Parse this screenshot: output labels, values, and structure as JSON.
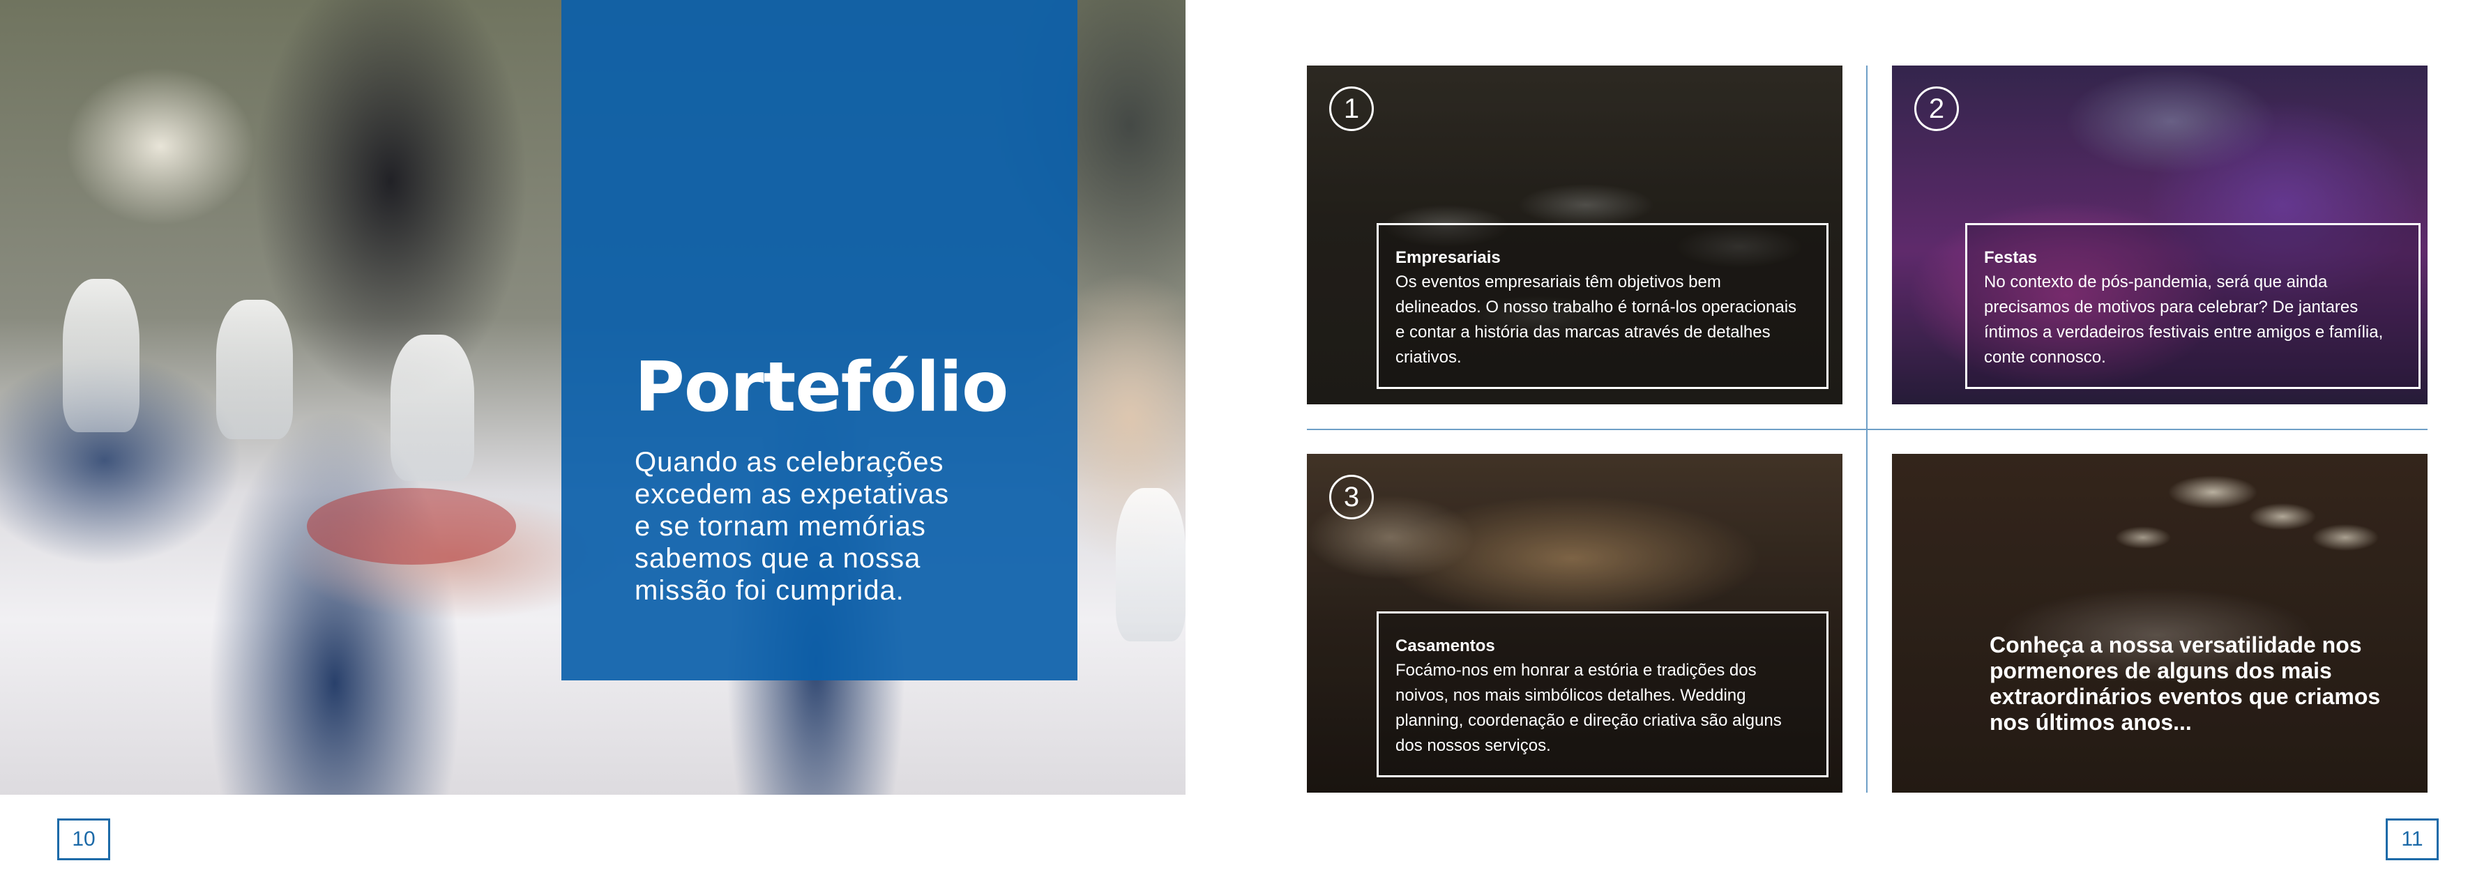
{
  "left_page": {
    "title": "Portefólio",
    "subtitle": "Quando as celebrações\nexcedem as expetativas\ne se tornam memórias\nsabemos que a nossa\nmissão foi cumprida.",
    "page_number": "10"
  },
  "right_page": {
    "cards": [
      {
        "number": "1",
        "title": "Empresariais",
        "body": "Os eventos empresariais têm objetivos bem delineados. O nosso trabalho é torná-los operacionais e contar a história das marcas através de detalhes criativos."
      },
      {
        "number": "2",
        "title": "Festas",
        "body": "No contexto de pós-pandemia, será que ainda precisamos de motivos para celebrar? De jantares íntimos a verdadeiros festivais entre amigos e família, conte connosco."
      },
      {
        "number": "3",
        "title": "Casamentos",
        "body": "Focámo-nos em honrar a estória e tradições dos noivos, nos mais simbólicos detalhes. Wedding planning, coordenação e direção criativa são alguns dos nossos serviços."
      }
    ],
    "closing_text": "Conheça a nossa versatilidade nos pormenores de alguns dos mais extraordinários eventos que criamos nos últimos anos...",
    "page_number": "11"
  },
  "colors": {
    "accent_blue": "#0b60aa",
    "grid_line": "#6e9fc7",
    "page_number": "#1c6aa8"
  }
}
